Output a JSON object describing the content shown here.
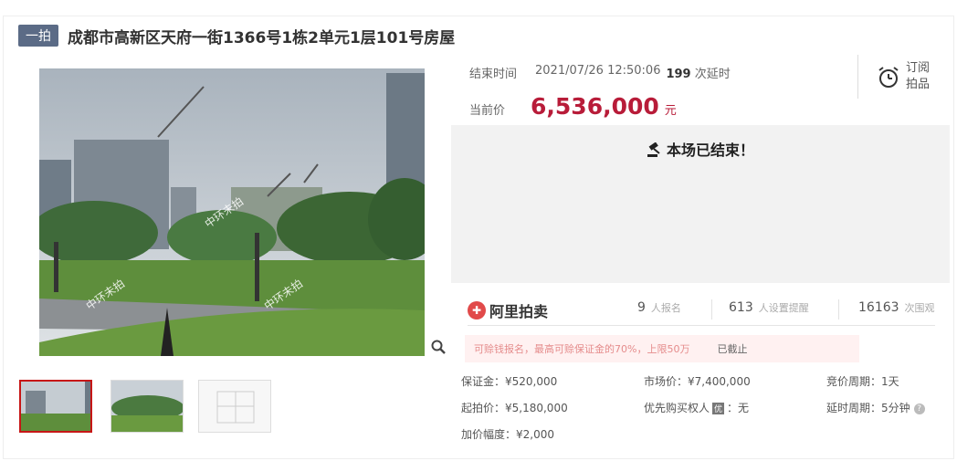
{
  "header": {
    "badge": "一拍",
    "title": "成都市高新区天府一街1366号1栋2单元1层101号房屋"
  },
  "auction": {
    "end_label": "结束时间",
    "end_time": "2021/07/26 12:50:06",
    "delay_count": "199",
    "delay_label": "次延时",
    "current_label": "当前价",
    "current_price": "6,536,000",
    "currency": "元",
    "subscribe_line1": "订阅",
    "subscribe_line2": "拍品",
    "ended_text": "本场已结束！"
  },
  "stats": {
    "brand": "阿里拍卖",
    "signups": "9",
    "signups_label": "人报名",
    "reminders": "613",
    "reminders_label": "人设置提醒",
    "views": "16163",
    "views_label": "次围观"
  },
  "notice": {
    "text": "可赊钱报名，最高可赊保证金的70%，上限50万",
    "status": "已截止"
  },
  "details": {
    "deposit": "保证金：¥520,000",
    "market_price": "市场价：¥7,400,000",
    "bid_period": "竞价周期：1天",
    "start_price": "起拍价：¥5,180,000",
    "priority_label": "优先购买权人",
    "priority_tag": "优",
    "priority_value": "：无",
    "delay_period": "延时周期：5分钟",
    "increment": "加价幅度：¥2,000"
  },
  "watermark": "中环未拍",
  "colors": {
    "accent": "#b81c39",
    "badge": "#5b6b86",
    "grey_panel": "#f2f2f2"
  },
  "icons": [
    "gavel-icon",
    "alarm-clock-icon",
    "zoom-icon",
    "help-icon"
  ]
}
